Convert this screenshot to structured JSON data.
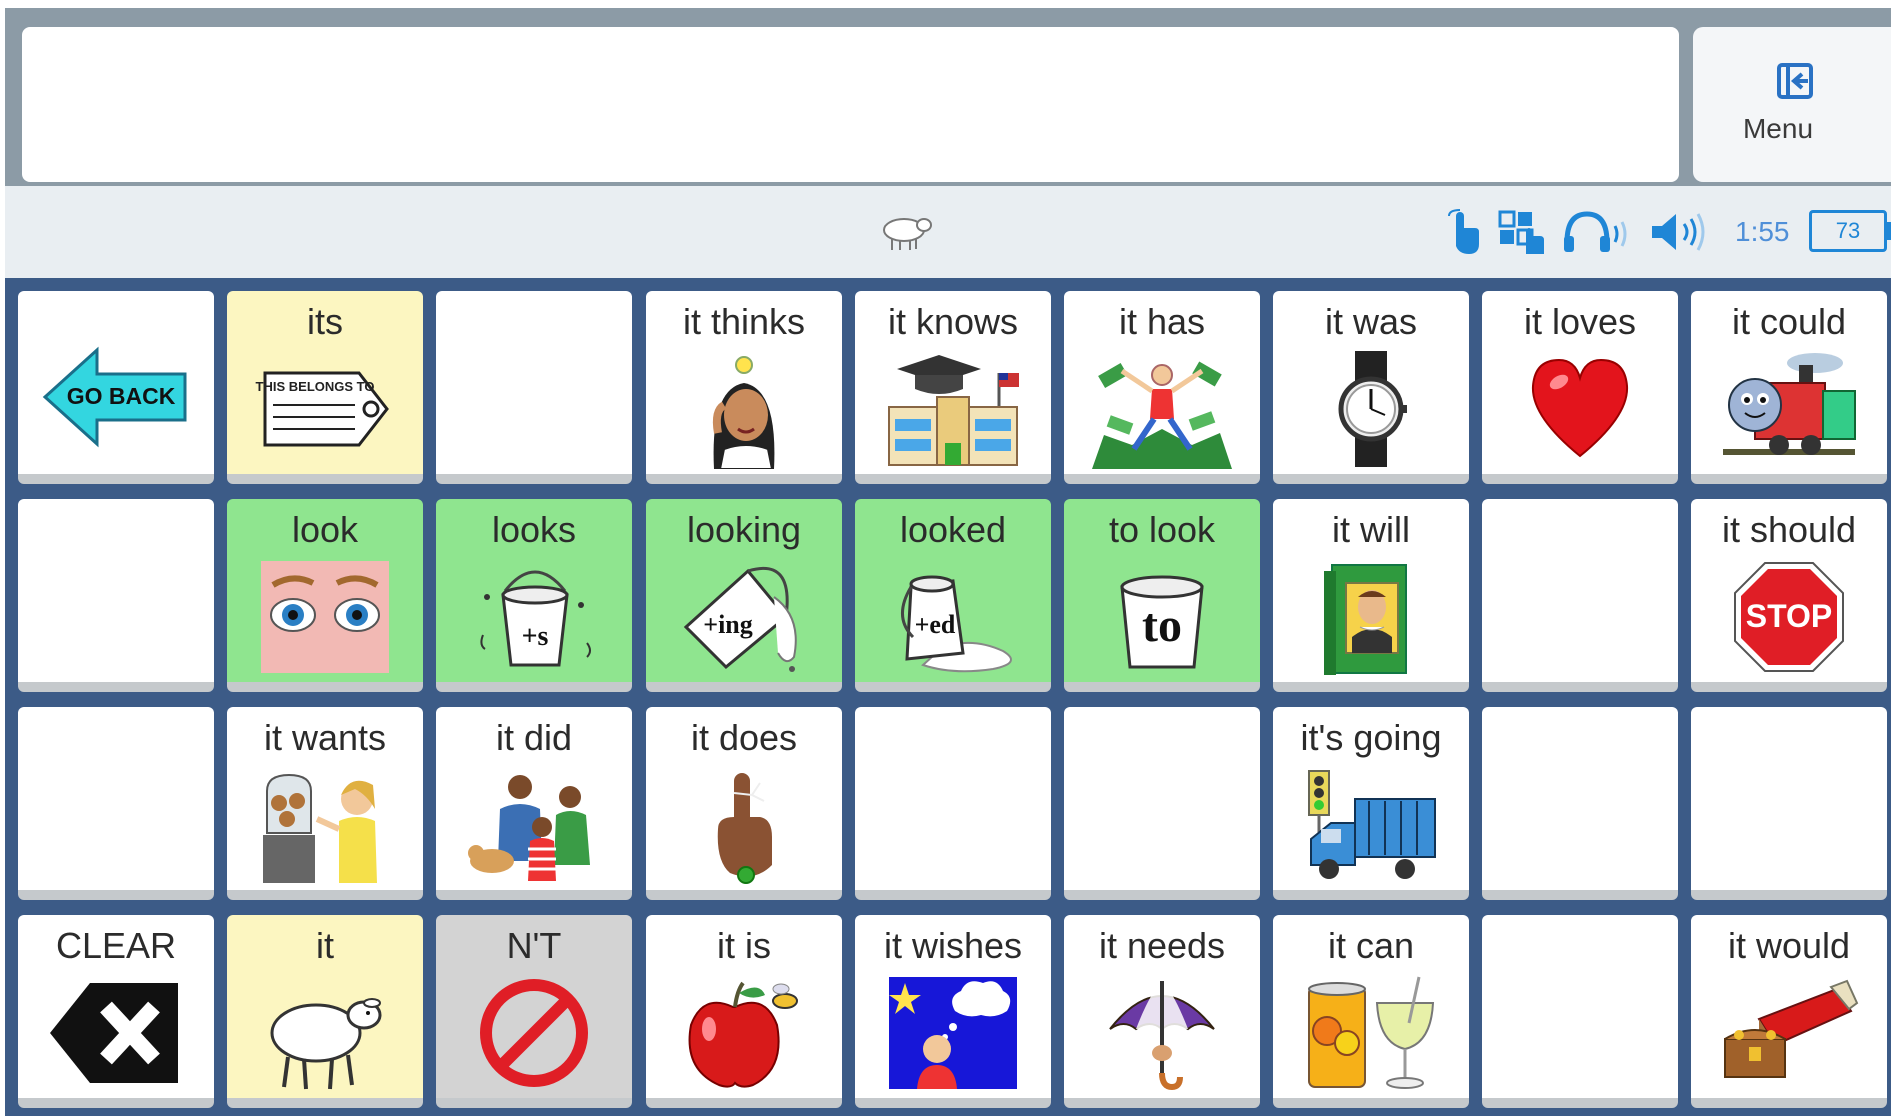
{
  "menu": {
    "label": "Menu"
  },
  "status": {
    "time": "1:55",
    "battery": "73"
  },
  "colors": {
    "yellow": "#fcf6c1",
    "green": "#8fe58f",
    "gray": "#d3d3d3",
    "grid_bg": "#3c5b87",
    "status_blue": "#1f86d6"
  },
  "cells": {
    "r0": [
      {
        "label": "",
        "icon": "go-back-arrow-icon",
        "icon_text": "GO BACK"
      },
      {
        "label": "its",
        "icon": "name-tag-icon",
        "icon_text": "THIS BELONGS TO"
      },
      {
        "label": "",
        "icon": ""
      },
      {
        "label": "it thinks",
        "icon": "thinking-woman-icon"
      },
      {
        "label": "it knows",
        "icon": "graduation-school-icon"
      },
      {
        "label": "it has",
        "icon": "money-man-icon"
      },
      {
        "label": "it was",
        "icon": "watch-icon"
      },
      {
        "label": "it loves",
        "icon": "heart-icon"
      },
      {
        "label": "it could",
        "icon": "train-icon"
      }
    ],
    "r1": [
      {
        "label": "",
        "icon": ""
      },
      {
        "label": "look",
        "icon": "eyes-icon"
      },
      {
        "label": "looks",
        "icon": "bucket-s-icon",
        "icon_text": "+s"
      },
      {
        "label": "looking",
        "icon": "bucket-ing-icon",
        "icon_text": "+ing"
      },
      {
        "label": "looked",
        "icon": "bucket-ed-icon",
        "icon_text": "+ed"
      },
      {
        "label": "to look",
        "icon": "bucket-to-icon",
        "icon_text": "to"
      },
      {
        "label": "it will",
        "icon": "shakespeare-book-icon"
      },
      {
        "label": "",
        "icon": ""
      },
      {
        "label": "it should",
        "icon": "stop-sign-icon",
        "icon_text": "STOP"
      }
    ],
    "r2": [
      {
        "label": "",
        "icon": ""
      },
      {
        "label": "it wants",
        "icon": "child-cookie-jar-icon"
      },
      {
        "label": "it did",
        "icon": "family-icon"
      },
      {
        "label": "it does",
        "icon": "finger-string-icon"
      },
      {
        "label": "",
        "icon": ""
      },
      {
        "label": "",
        "icon": ""
      },
      {
        "label": "it's going",
        "icon": "truck-traffic-light-icon"
      },
      {
        "label": "",
        "icon": ""
      },
      {
        "label": "",
        "icon": ""
      }
    ],
    "r3": [
      {
        "label": "CLEAR",
        "icon": "clear-x-icon"
      },
      {
        "label": "it",
        "icon": "sheep-icon"
      },
      {
        "label": "N'T",
        "icon": "no-sign-icon"
      },
      {
        "label": "it is",
        "icon": "apple-bee-icon"
      },
      {
        "label": "it wishes",
        "icon": "wish-boy-icon"
      },
      {
        "label": "it needs",
        "icon": "umbrella-icon"
      },
      {
        "label": "it can",
        "icon": "can-glass-icon"
      },
      {
        "label": "",
        "icon": ""
      },
      {
        "label": "it would",
        "icon": "bed-treasure-icon"
      }
    ]
  }
}
